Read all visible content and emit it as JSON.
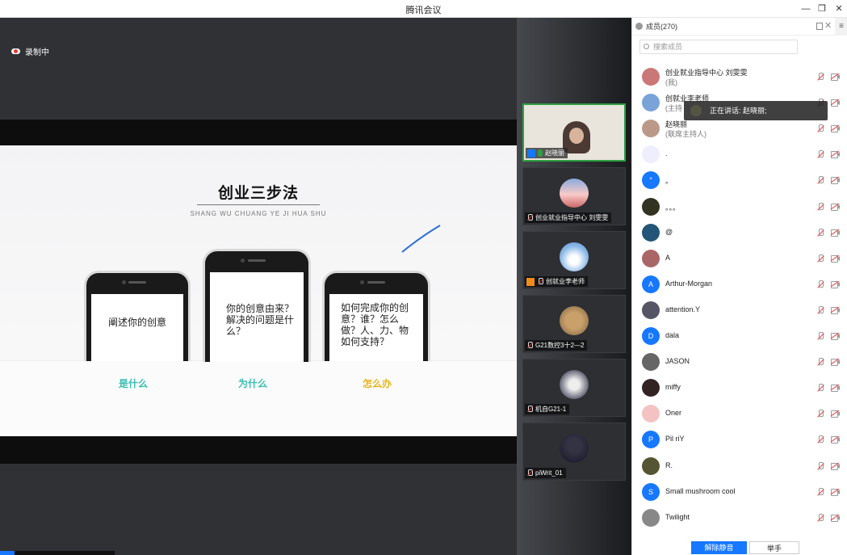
{
  "window": {
    "title": "腾讯会议",
    "minimize": "—",
    "restore": "❐",
    "close": "✕"
  },
  "recording": {
    "label": "录制中"
  },
  "slide": {
    "title": "创业三步法",
    "subtitle": "SHANG WU CHUANG YE JI HUA SHU",
    "phones": [
      {
        "text": "阐述你的创意"
      },
      {
        "text": "你的创意由来？解决的问题是什么？"
      },
      {
        "text": "如何完成你的创意？谁？怎么做？人、力、物如何支持？"
      }
    ],
    "steps": [
      {
        "label": "是什么",
        "color": "#3bbfb0"
      },
      {
        "label": "为什么",
        "color": "#3bbfb0"
      },
      {
        "label": "怎么办",
        "color": "#e8b51a"
      }
    ]
  },
  "gallery": [
    {
      "name": "赵晓丽",
      "active": true
    },
    {
      "name": "创业就业指导中心 刘雯雯",
      "active": false
    },
    {
      "name": "创就业李老师",
      "active": false
    },
    {
      "name": "G21数控3十2—2",
      "active": false
    },
    {
      "name": "机自G21-1",
      "active": false
    },
    {
      "name": "piWrit_01",
      "active": false
    }
  ],
  "panel": {
    "header": "成员(270)",
    "search_placeholder": "搜索成员",
    "tooltip": "正在讲话: 赵晓丽;",
    "members": [
      {
        "name": "创业就业指导中心 刘雯雯",
        "role": "(我)",
        "avatar": "",
        "color": "#c77"
      },
      {
        "name": "创就业李老师",
        "role": "(主持",
        "avatar": "",
        "color": "#7aa3d8"
      },
      {
        "name": "赵晓丽",
        "role": "(联席主持人)",
        "avatar": "",
        "color": "#b98"
      },
      {
        "name": ".",
        "role": "",
        "avatar": "",
        "color": "#eef"
      },
      {
        "name": "。",
        "role": "",
        "avatar": "°",
        "color": "#1677ff"
      },
      {
        "name": "。。。",
        "role": "",
        "avatar": "",
        "color": "#332"
      },
      {
        "name": "@",
        "role": "",
        "avatar": "",
        "color": "#257"
      },
      {
        "name": "A",
        "role": "",
        "avatar": "",
        "color": "#a66"
      },
      {
        "name": "Arthur-Morgan",
        "role": "",
        "avatar": "A",
        "color": "#1677ff"
      },
      {
        "name": "attention.Y",
        "role": "",
        "avatar": "",
        "color": "#556"
      },
      {
        "name": "dala",
        "role": "",
        "avatar": "D",
        "color": "#1677ff"
      },
      {
        "name": "JASON",
        "role": "",
        "avatar": "",
        "color": "#666"
      },
      {
        "name": "miffy",
        "role": "",
        "avatar": "",
        "color": "#322"
      },
      {
        "name": "Oner",
        "role": "",
        "avatar": "",
        "color": "#f3c3c3"
      },
      {
        "name": "Pil riY",
        "role": "",
        "avatar": "P",
        "color": "#1677ff"
      },
      {
        "name": "R.",
        "role": "",
        "avatar": "",
        "color": "#553"
      },
      {
        "name": "Small mushroom cool",
        "role": "",
        "avatar": "S",
        "color": "#1677ff"
      },
      {
        "name": "Twilight",
        "role": "",
        "avatar": "",
        "color": "#888"
      }
    ],
    "unmute_all": "解除静音",
    "raise_hand": "举手"
  }
}
